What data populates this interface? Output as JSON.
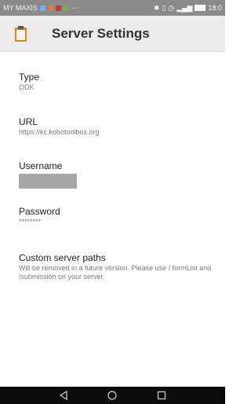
{
  "status_bar": {
    "carrier": "MY MAXIS",
    "overflow": "···",
    "time": "18:0",
    "icons_left": [
      "notification-square-icon",
      "app-notification-icon",
      "app-notification-icon",
      "whatsapp-icon"
    ],
    "icons_right": [
      "bluetooth-icon",
      "vibrate-icon",
      "alarm-icon",
      "signal-icon",
      "battery-icon"
    ]
  },
  "toolbar": {
    "title": "Server Settings",
    "icon": "clipboard-icon"
  },
  "preferences": {
    "type": {
      "title": "Type",
      "summary": "ODK"
    },
    "url": {
      "title": "URL",
      "summary": "https://kc.kobotoolbox.org"
    },
    "username": {
      "title": "Username"
    },
    "password": {
      "title": "Password",
      "summary": "********"
    },
    "custom_paths": {
      "title": "Custom server paths",
      "summary": "Will be removed in a future version. Please use / formList and /submission on your server."
    }
  },
  "nav_bar": {
    "buttons": [
      "back-icon",
      "home-icon",
      "recents-icon"
    ]
  },
  "colors": {
    "status_bar": "#8a8a8a",
    "toolbar": "#ececec",
    "icon_accent": "#d98a1c",
    "title_text": "#333333",
    "summary_text": "#7a7a7a",
    "nav_bar": "#0b0b0b"
  }
}
